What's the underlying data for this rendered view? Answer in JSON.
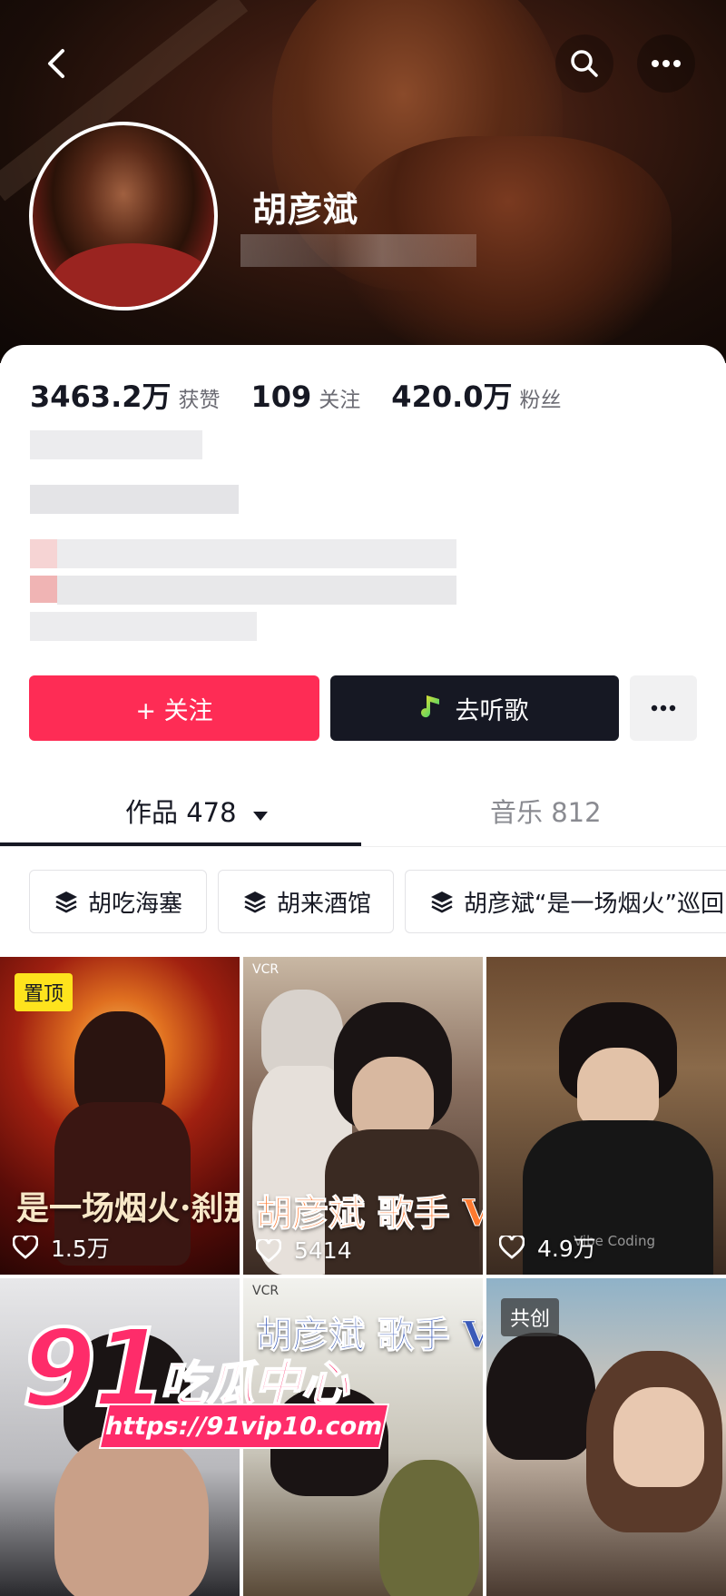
{
  "profile": {
    "name": "胡彦斌",
    "stats": [
      {
        "value": "3463.2万",
        "label": "获赞"
      },
      {
        "value": "109",
        "label": "关注"
      },
      {
        "value": "420.0万",
        "label": "粉丝"
      }
    ]
  },
  "actions": {
    "follow_label": "+ 关注",
    "listen_label": "去听歌",
    "more_label": "···"
  },
  "tabs": [
    {
      "label": "作品 478"
    },
    {
      "label": "音乐 812"
    }
  ],
  "collections": [
    {
      "label": "胡吃海塞"
    },
    {
      "label": "胡来酒馆"
    },
    {
      "label": "胡彦斌“是一场烟火”巡回"
    }
  ],
  "videos": [
    {
      "badge": "置顶",
      "likes": "1.5万",
      "poster_text": "是一场烟火·刹那"
    },
    {
      "likes": "5414",
      "poster_text": "胡彦斌 歌手 VLOG",
      "corner_text": "VCR"
    },
    {
      "likes": "4.9万",
      "caption": "Vibe Coding"
    },
    {},
    {
      "poster_text": "胡彦斌 歌手 VLOG",
      "corner_text": "VCR"
    },
    {
      "badge": "共创"
    }
  ],
  "watermark": {
    "number": "91",
    "text": "吃瓜中心",
    "url": "https://91vip10.com"
  }
}
